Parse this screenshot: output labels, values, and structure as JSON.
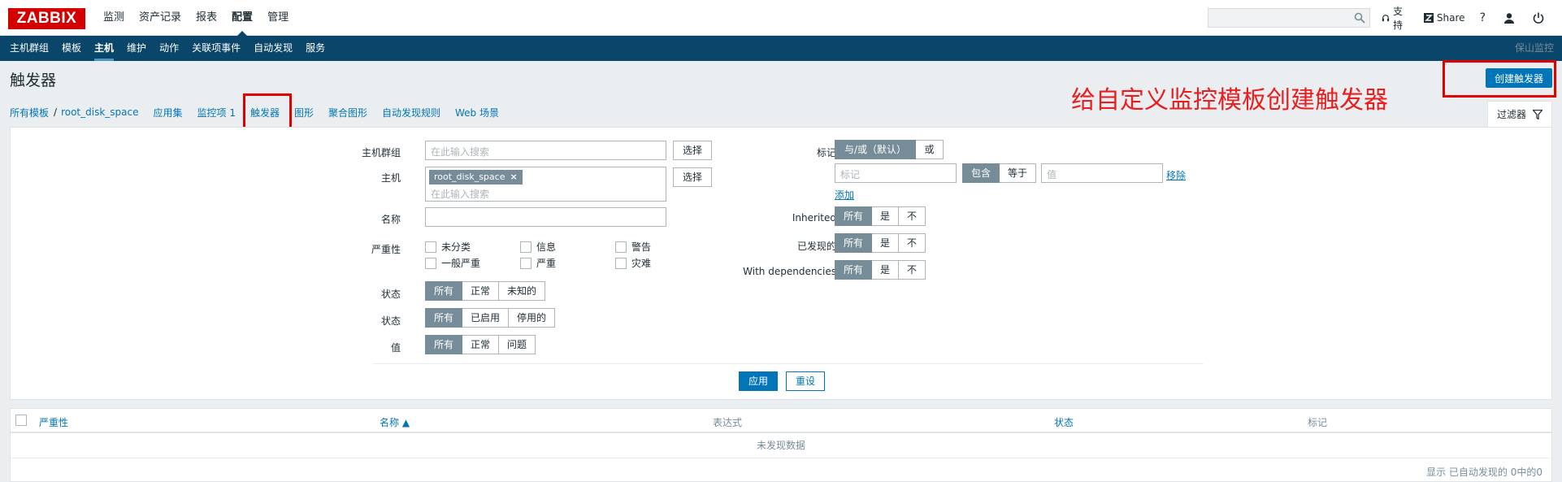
{
  "header": {
    "logo": "ZABBIX",
    "nav": [
      "监测",
      "资产记录",
      "报表",
      "配置",
      "管理"
    ],
    "active_nav": "配置",
    "support": "支持",
    "share": "Share",
    "help": "?"
  },
  "subnav": {
    "items": [
      "主机群组",
      "模板",
      "主机",
      "维护",
      "动作",
      "关联项事件",
      "自动发现",
      "服务"
    ],
    "active": "主机",
    "right_text": "保山监控"
  },
  "page": {
    "title": "触发器",
    "create_button": "创建触发器",
    "annotation": "给自定义监控模板创建触发器"
  },
  "breadcrumb": {
    "all_templates": "所有模板",
    "separator": "/",
    "template": "root_disk_space",
    "apps": "应用集",
    "items": "监控项 1",
    "triggers": "触发器",
    "graphs": "图形",
    "screens": "聚合图形",
    "discovery": "自动发现规则",
    "web": "Web 场景"
  },
  "filter_tab": "过滤器",
  "filter": {
    "host_group_label": "主机群组",
    "host_group_placeholder": "在此输入搜索",
    "select_btn": "选择",
    "host_label": "主机",
    "host_tag": "root_disk_space",
    "host_placeholder": "在此输入搜索",
    "name_label": "名称",
    "severity_label": "严重性",
    "severities": [
      "未分类",
      "信息",
      "警告",
      "一般严重",
      "严重",
      "灾难"
    ],
    "state_label": "状态",
    "state_options": [
      "所有",
      "正常",
      "未知的"
    ],
    "status_label": "状态",
    "status_options": [
      "所有",
      "已启用",
      "停用的"
    ],
    "value_label": "值",
    "value_options": [
      "所有",
      "正常",
      "问题"
    ],
    "tags_label": "标记",
    "tags_mode": [
      "与/或（默认）",
      "或"
    ],
    "tag_placeholder": "标记",
    "tag_ops": [
      "包含",
      "等于"
    ],
    "tag_value_placeholder": "值",
    "remove": "移除",
    "add": "添加",
    "inherited_label": "Inherited",
    "discovered_label": "已发现的",
    "deps_label": "With dependencies",
    "yes_no": [
      "所有",
      "是",
      "不"
    ],
    "apply": "应用",
    "reset": "重设"
  },
  "table": {
    "columns": {
      "severity": "严重性",
      "name": "名称 ▲",
      "expression": "表达式",
      "status": "状态",
      "tags": "标记"
    },
    "no_data": "未发现数据"
  },
  "footer": "显示 已自动发现的 0中的0"
}
